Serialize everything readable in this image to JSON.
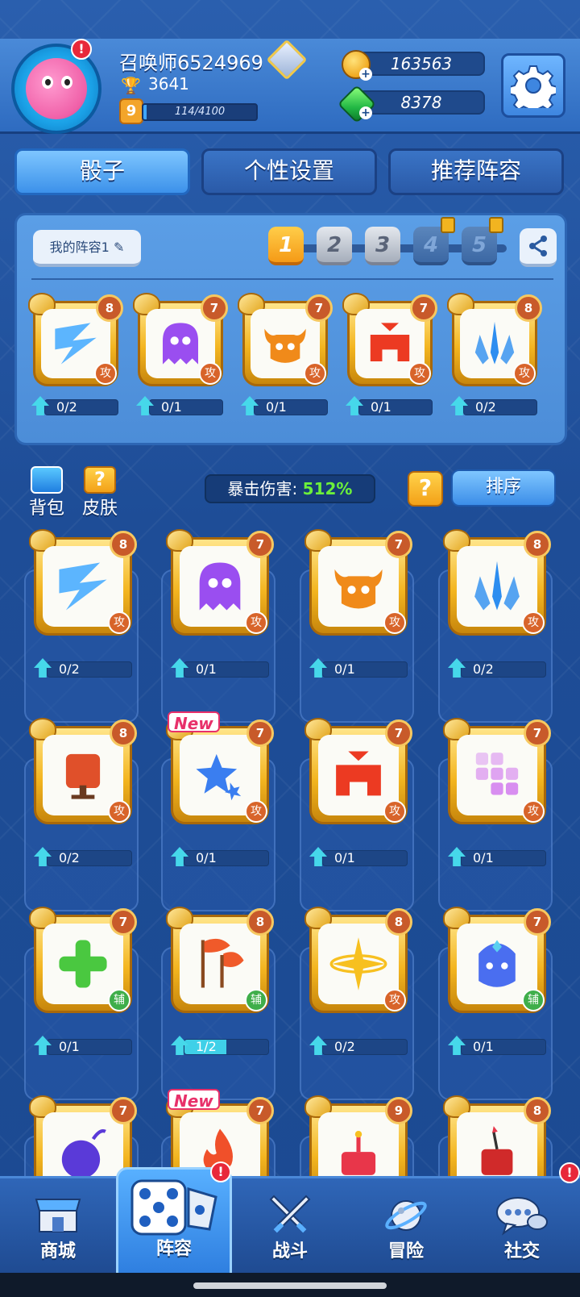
{
  "header": {
    "player_name": "召唤师6524969",
    "trophies": "3641",
    "level": "9",
    "xp_text": "114/4100",
    "xp_progress": 0.028,
    "gold": "163563",
    "gems": "8378",
    "avatar_alert": "!"
  },
  "tabs": [
    {
      "label": "骰子",
      "active": true
    },
    {
      "label": "个性设置",
      "active": false
    },
    {
      "label": "推荐阵容",
      "active": false
    }
  ],
  "deck": {
    "name_label": "我的阵容1",
    "slots": [
      {
        "label": "1",
        "state": "active"
      },
      {
        "label": "2",
        "state": "normal"
      },
      {
        "label": "3",
        "state": "normal"
      },
      {
        "label": "4",
        "state": "locked"
      },
      {
        "label": "5",
        "state": "locked"
      }
    ],
    "dice": [
      {
        "icon": "lightning-icon",
        "level": "8",
        "type": "攻",
        "progress": "0/2",
        "fill": 0.0,
        "color": "#3fa8ff"
      },
      {
        "icon": "ghost-icon",
        "level": "7",
        "type": "攻",
        "progress": "0/1",
        "fill": 0.0,
        "color": "#9a4ef0"
      },
      {
        "icon": "bull-icon",
        "level": "7",
        "type": "攻",
        "progress": "0/1",
        "fill": 0.0,
        "color": "#f08a1a"
      },
      {
        "icon": "helmet-icon",
        "level": "7",
        "type": "攻",
        "progress": "0/1",
        "fill": 0.0,
        "color": "#ec3a22"
      },
      {
        "icon": "ice-spike-icon",
        "level": "8",
        "type": "攻",
        "progress": "0/2",
        "fill": 0.0,
        "color": "#2d8ef0"
      }
    ]
  },
  "toolbar": {
    "bag_label": "背包",
    "skin_label": "皮肤",
    "crit_label": "暴击伤害:",
    "crit_value": "512%",
    "help_label": "?",
    "sort_label": "排序"
  },
  "collection": [
    {
      "icon": "lightning-icon",
      "level": "8",
      "type": "攻",
      "progress": "0/2",
      "fill": 0.0,
      "color": "#3fa8ff",
      "new": false
    },
    {
      "icon": "ghost-icon",
      "level": "7",
      "type": "攻",
      "progress": "0/1",
      "fill": 0.0,
      "color": "#9a4ef0",
      "new": false
    },
    {
      "icon": "bull-icon",
      "level": "7",
      "type": "攻",
      "progress": "0/1",
      "fill": 0.0,
      "color": "#f08a1a",
      "new": false
    },
    {
      "icon": "ice-spike-icon",
      "level": "8",
      "type": "攻",
      "progress": "0/2",
      "fill": 0.0,
      "color": "#2d8ef0",
      "new": false
    },
    {
      "icon": "banner-icon",
      "level": "8",
      "type": "攻",
      "progress": "0/2",
      "fill": 0.0,
      "color": "#e0502a",
      "new": false
    },
    {
      "icon": "star-icon",
      "level": "7",
      "type": "攻",
      "progress": "0/1",
      "fill": 0.0,
      "color": "#3a7ef0",
      "new": true
    },
    {
      "icon": "helmet-icon",
      "level": "7",
      "type": "攻",
      "progress": "0/1",
      "fill": 0.0,
      "color": "#ec3a22",
      "new": false
    },
    {
      "icon": "blocks-icon",
      "level": "7",
      "type": "攻",
      "progress": "0/1",
      "fill": 0.0,
      "color": "#d88ef0",
      "new": false
    },
    {
      "icon": "plus-icon",
      "level": "7",
      "type": "辅",
      "progress": "0/1",
      "fill": 0.0,
      "color": "#4ac840",
      "new": false
    },
    {
      "icon": "flags-icon",
      "level": "8",
      "type": "辅",
      "progress": "1/2",
      "fill": 0.5,
      "color": "#f05a2a",
      "new": false
    },
    {
      "icon": "sparkle-icon",
      "level": "8",
      "type": "攻",
      "progress": "0/2",
      "fill": 0.0,
      "color": "#f7c020",
      "new": false
    },
    {
      "icon": "mask-icon",
      "level": "7",
      "type": "辅",
      "progress": "0/1",
      "fill": 0.0,
      "color": "#4a6ef0",
      "new": false
    },
    {
      "icon": "bomb-icon",
      "level": "7",
      "type": "",
      "progress": "",
      "fill": 0.0,
      "color": "#5a3ad8",
      "new": false
    },
    {
      "icon": "fire-icon",
      "level": "7",
      "type": "",
      "progress": "",
      "fill": 0.0,
      "color": "#f0502a",
      "new": true
    },
    {
      "icon": "cake-icon",
      "level": "9",
      "type": "",
      "progress": "",
      "fill": 0.0,
      "color": "#e8364a",
      "new": false
    },
    {
      "icon": "dynamite-icon",
      "level": "8",
      "type": "",
      "progress": "",
      "fill": 0.0,
      "color": "#d02a2a",
      "new": false
    }
  ],
  "new_label": "New",
  "nav": [
    {
      "label": "商城",
      "icon": "shop-icon",
      "active": false,
      "alert": false
    },
    {
      "label": "阵容",
      "icon": "dice-icon",
      "active": true,
      "alert": true
    },
    {
      "label": "战斗",
      "icon": "swords-icon",
      "active": false,
      "alert": false
    },
    {
      "label": "冒险",
      "icon": "planet-icon",
      "active": false,
      "alert": false
    },
    {
      "label": "社交",
      "icon": "chat-icon",
      "active": false,
      "alert": true
    }
  ],
  "alert_mark": "!"
}
